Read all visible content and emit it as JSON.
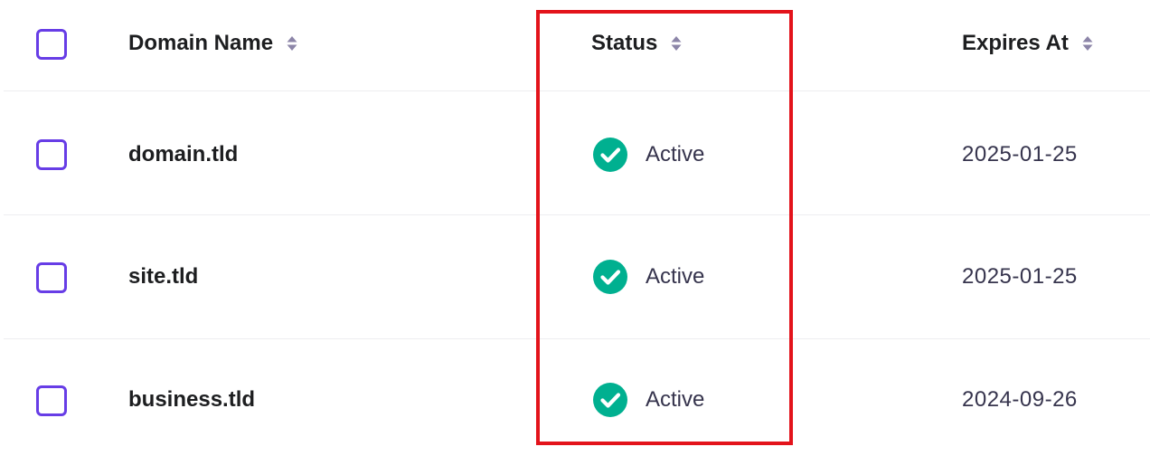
{
  "table": {
    "columns": {
      "domain": "Domain Name",
      "status": "Status",
      "expires": "Expires At"
    },
    "rows": [
      {
        "domain": "domain.tld",
        "status": "Active",
        "expires": "2025-01-25"
      },
      {
        "domain": "site.tld",
        "status": "Active",
        "expires": "2025-01-25"
      },
      {
        "domain": "business.tld",
        "status": "Active",
        "expires": "2024-09-26"
      }
    ]
  },
  "colors": {
    "checkbox_border": "#673de6",
    "status_active": "#00b090",
    "highlight": "#e3131b"
  },
  "icons": {
    "sort": "sort-icon",
    "status": "check-circle-icon"
  }
}
